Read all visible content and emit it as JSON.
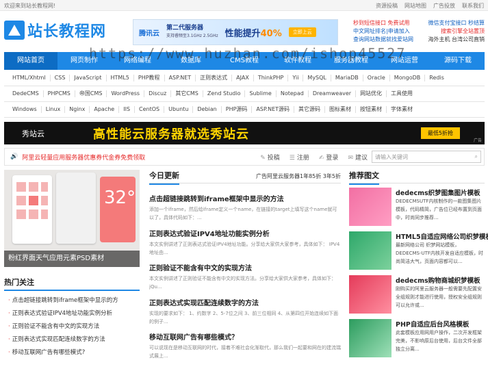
{
  "topbar": {
    "welcome": "欢迎来到站长教程网!",
    "links": [
      "资源投稿",
      "网站地图",
      "广告投放",
      "联系我们"
    ]
  },
  "logo": {
    "text": "站长教程网"
  },
  "banner1": {
    "brand": "腾讯云",
    "srv": "第二代服务器",
    "srv_sub": "支持睿频至3.1GHz  2.5GHz",
    "perf": "性能提升",
    "perf_pct": "40%",
    "btn": "立即上云"
  },
  "adlinks": [
    [
      "秒到短信接口 免费试用",
      "微信支付宝接口 秒结算"
    ],
    [
      "中文网址排名|申请加入",
      "搜索引擎全站置顶"
    ],
    [
      "查询网站数据就找爱站网",
      "海外主机 台湾公司直销"
    ]
  ],
  "nav": [
    "网站首页",
    "网页制作",
    "网络编程",
    "数据库",
    "CMS教程",
    "软件教程",
    "服务器教程",
    "网站运营",
    "源码下载"
  ],
  "tag_rows": [
    [
      "HTML/Xhtml",
      "CSS",
      "JavaScript",
      "HTML5",
      "PHP教程",
      "ASP.NET",
      "正则表达式",
      "AJAX",
      "ThinkPHP",
      "Yii",
      "MySQL",
      "MariaDB",
      "Oracle",
      "MongoDB",
      "Redis"
    ],
    [
      "DedeCMS",
      "PHPCMS",
      "帝国CMS",
      "WordPress",
      "Discuz",
      "其它CMS",
      "Zend Studio",
      "Sublime",
      "Notepad",
      "Dreamweaver",
      "网站优化",
      "工具使用"
    ],
    [
      "Windows",
      "Linux",
      "Nginx",
      "Apache",
      "IIS",
      "CentOS",
      "Ubuntu",
      "Debian",
      "PHP源码",
      "ASP.NET源码",
      "其它源码",
      "图标素材",
      "按钮素材",
      "字体素材"
    ]
  ],
  "banner2": {
    "left": "秀站云",
    "main": "高性能云服务器就选秀站云",
    "btn": "最低5折抢",
    "ad": "广告"
  },
  "notice": {
    "text": "阿里云轻量应用服务器优惠券代金券免费领取",
    "actions": [
      "投稿",
      "注册",
      "登录",
      "建议"
    ],
    "search_placeholder": "请输入关键词"
  },
  "slide": {
    "caption": "粉红界面天气应用元素PSD素材",
    "temp": "32°"
  },
  "hot": {
    "title": "热门关注",
    "items": [
      "点击超链接跳转到iframe框架中显示的方",
      "正则表达式验证IPV4地址功能实例分析",
      "正则验证不能含有中文的实现方法",
      "正则表达式实现匹配连续数字的方法",
      "移动互联网广告有哪些模式?"
    ]
  },
  "middle": {
    "title": "今日更新",
    "ad": "广告阿里云服务器1年85折 3年5折",
    "articles": [
      {
        "h": "点击超链接跳转到iframe框架中显示的方法",
        "d": "添加一个iframe，然后给iframe定义一个name，在链接的target上填写这个name就可以了，具体代码如下：..."
      },
      {
        "h": "正则表达式验证IPV4地址功能实例分析",
        "d": "本文实例讲述了正则表达式验证IPV4地址功能。分享给大家供大家参考，具体如下：  IPV4地址由..."
      },
      {
        "h": "正则验证不能含有中文的实现方法",
        "d": "本文实例讲述了正则验证不能含有中文的实现方法。分享给大家供大家参考，具体如下：  jQu..."
      },
      {
        "h": "正则表达式实现匹配连续数字的方法",
        "d": "实现的要求如下：  1、约数字 2、5-7位之间 3、前三位相同 4、从第四位开始连续如下面的例子..."
      },
      {
        "h": "移动互联网广告有哪些模式？",
        "d": "可以说现在是移动互联网的时代，接着不难社会化渐取代，那么我们一起要和网在的建流瑞式展上..."
      }
    ]
  },
  "right": {
    "title": "推荐图文",
    "cards": [
      {
        "h": "dedecms织梦图集图片模板",
        "d": "DEDECMSUTF内核制作的一款图集图片模板，代码精简，广告位已经布置到页面中，时尚同步推荐..."
      },
      {
        "h": "HTML5自适应网络公司织梦模板",
        "d": "最新网络公司 织梦网站模板，DEDECMS-UTF内核开发自适应模板，时尚简洁大气，页面内容都可以..."
      },
      {
        "h": "dedecms购物商城织梦模板",
        "d": "刚购买的阿里云服务器一般需要先配置安全组规则才能进行使用，授权安全组规则可以允许或..."
      },
      {
        "h": "PHP自适应后台风格模板",
        "d": "此套模板应用网用户操作，二次开发框架完美，不影响原后台使用，后台文件全部独立分离..."
      }
    ]
  },
  "watermark": "https://www.huzhan.com/ishop45527"
}
